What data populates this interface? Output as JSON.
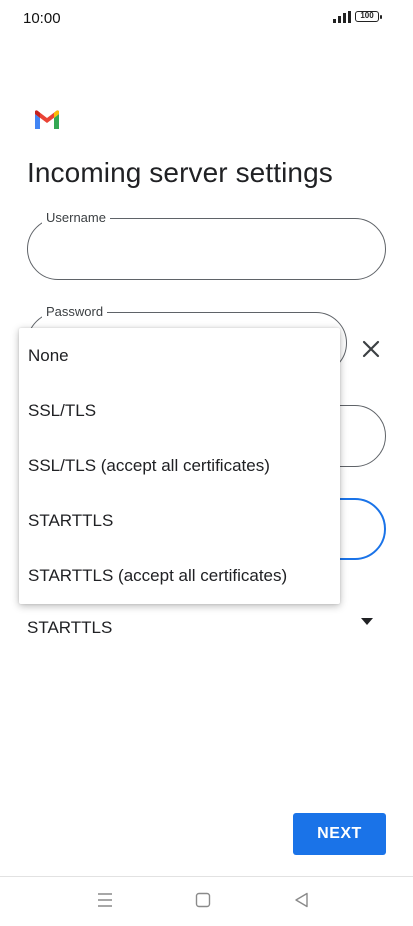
{
  "status_bar": {
    "time": "10:00",
    "battery": "100"
  },
  "page": {
    "title": "Incoming server settings"
  },
  "fields": {
    "username_label": "Username",
    "password_label": "Password"
  },
  "security": {
    "selected": "STARTTLS"
  },
  "dropdown": {
    "options": [
      "None",
      "SSL/TLS",
      "SSL/TLS (accept all certificates)",
      "STARTTLS",
      "STARTTLS (accept all certificates)"
    ]
  },
  "actions": {
    "next_label": "NEXT"
  },
  "icons": {
    "gmail": "gmail-logo-icon",
    "clear": "close-icon",
    "dropdown": "arrow-drop-down-icon",
    "nav_menu": "menu-icon",
    "nav_home": "square-home-icon",
    "nav_back": "triangle-back-icon"
  },
  "colors": {
    "accent": "#1a73e8",
    "gmail_red": "#ea4335",
    "gmail_blue": "#4285f4",
    "gmail_green": "#34a853",
    "gmail_yellow": "#fbbc04"
  }
}
